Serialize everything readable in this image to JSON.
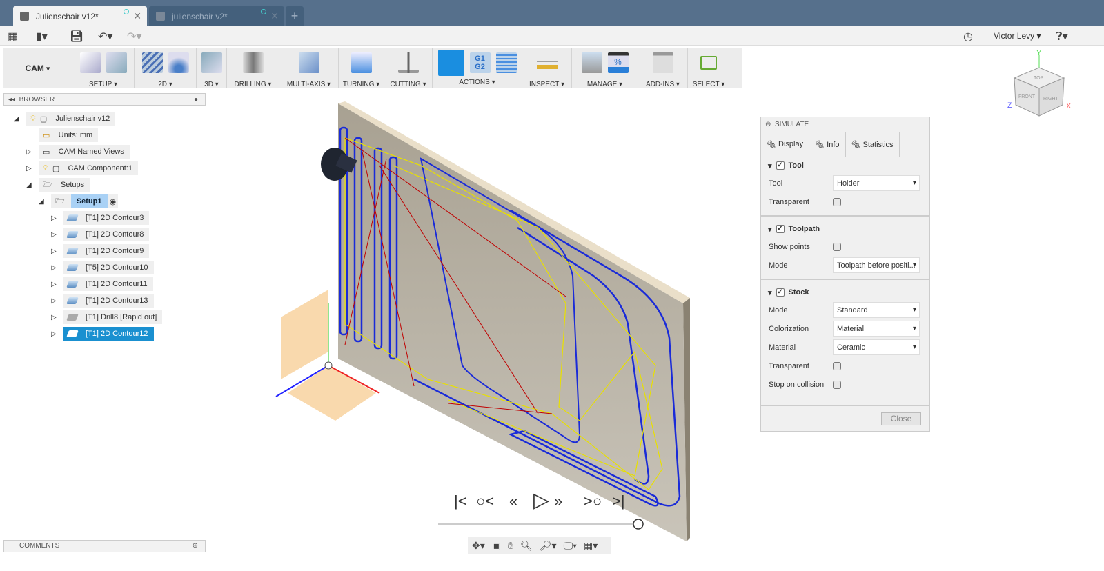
{
  "tabs": [
    {
      "label": "Julienschair v12*",
      "active": true
    },
    {
      "label": "julienschair v2*",
      "active": false
    }
  ],
  "user": {
    "name": "Victor Levy"
  },
  "workspace": {
    "label": "CAM"
  },
  "ribbon": [
    {
      "label": "SETUP"
    },
    {
      "label": "2D"
    },
    {
      "label": "3D"
    },
    {
      "label": "DRILLING"
    },
    {
      "label": "MULTI-AXIS"
    },
    {
      "label": "TURNING"
    },
    {
      "label": "CUTTING"
    },
    {
      "label": "ACTIONS"
    },
    {
      "label": "INSPECT"
    },
    {
      "label": "MANAGE"
    },
    {
      "label": "ADD-INS"
    },
    {
      "label": "SELECT"
    }
  ],
  "actions_icons": {
    "g1g2": "G1\nG2",
    "percent": "%"
  },
  "browser": {
    "title": "BROWSER",
    "items": [
      {
        "label": "Julienschair v12"
      },
      {
        "label": "Units: mm"
      },
      {
        "label": "CAM Named Views"
      },
      {
        "label": "CAM Component:1"
      },
      {
        "label": "Setups"
      },
      {
        "label": "Setup1"
      },
      {
        "label": "[T1] 2D Contour3"
      },
      {
        "label": "[T1] 2D Contour8"
      },
      {
        "label": "[T1] 2D Contour9"
      },
      {
        "label": "[T5] 2D Contour10"
      },
      {
        "label": "[T1] 2D Contour11"
      },
      {
        "label": "[T1] 2D Contour13"
      },
      {
        "label": "[T1] Drill8 [Rapid out]"
      },
      {
        "label": "[T1] 2D Contour12"
      }
    ]
  },
  "comments": {
    "title": "COMMENTS"
  },
  "viewcube": {
    "top": "TOP",
    "front": "FRONT",
    "right": "RIGHT",
    "x": "X",
    "y": "Y",
    "z": "Z"
  },
  "simulate": {
    "title": "SIMULATE",
    "tabs": [
      "Display",
      "Info",
      "Statistics"
    ],
    "tool": {
      "title": "Tool",
      "tool_label": "Tool",
      "tool_value": "Holder",
      "transparent": "Transparent"
    },
    "toolpath": {
      "title": "Toolpath",
      "show_points": "Show points",
      "mode_label": "Mode",
      "mode_value": "Toolpath before positi..."
    },
    "stock": {
      "title": "Stock",
      "mode_label": "Mode",
      "mode_value": "Standard",
      "colorization_label": "Colorization",
      "colorization_value": "Material",
      "material_label": "Material",
      "material_value": "Ceramic",
      "transparent": "Transparent",
      "stop": "Stop on collision"
    },
    "close": "Close"
  },
  "playback": {
    "progress": 1.0
  }
}
